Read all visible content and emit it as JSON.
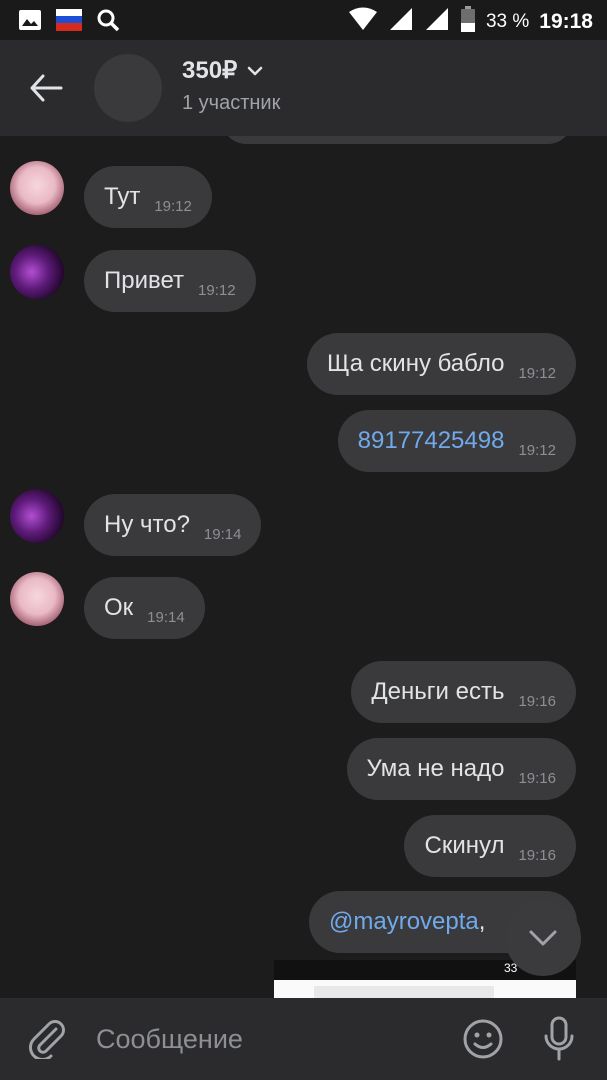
{
  "status_bar": {
    "battery": "33 %",
    "time": "19:18",
    "icons": [
      "gallery-icon",
      "russia-flag-icon",
      "search-icon",
      "wifi-icon",
      "signal-icon",
      "signal-icon",
      "battery-icon"
    ]
  },
  "header": {
    "title": "350₽",
    "subtitle": "1 участник"
  },
  "messages": [
    {
      "text": "Тут",
      "time": "19:12",
      "side": "in",
      "avatar": "a"
    },
    {
      "text": "Привет",
      "time": "19:12",
      "side": "in",
      "avatar": "b"
    },
    {
      "text": "Ща скину бабло",
      "time": "19:12",
      "side": "out"
    },
    {
      "text": "89177425498",
      "time": "19:12",
      "side": "out",
      "link": true
    },
    {
      "text": "Ну что?",
      "time": "19:14",
      "side": "in",
      "avatar": "b"
    },
    {
      "text": "Ок",
      "time": "19:14",
      "side": "in",
      "avatar": "a"
    },
    {
      "text": "Деньги есть",
      "time": "19:16",
      "side": "out"
    },
    {
      "text": "Ума не надо",
      "time": "19:16",
      "side": "out"
    },
    {
      "text": "Скинул",
      "time": "19:16",
      "side": "out"
    },
    {
      "text": "@mayrovepta",
      "suffix": ",",
      "side": "out",
      "link": true
    }
  ],
  "preview": {
    "status_text": "33"
  },
  "composer": {
    "placeholder": "Сообщение"
  },
  "colors": {
    "background": "#1c1c1d",
    "bubble": "#3a3a3c",
    "link": "#71aaeb",
    "header": "#2b2b2d"
  }
}
